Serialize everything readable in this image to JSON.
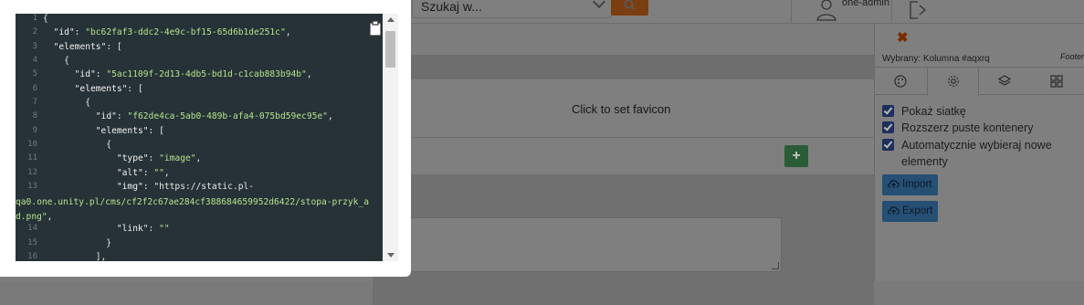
{
  "topbar": {
    "search_text": "Szukaj w...",
    "user_name": "one-admin"
  },
  "canvas": {
    "favicon_text": "Click to set favicon",
    "add_symbol": "+"
  },
  "panel": {
    "close_symbol": "✖",
    "selected_text": "Wybrany: Kolumna #aqxrq",
    "footer_tag": "Footer",
    "tabs": [
      {
        "icon": "palette-icon",
        "active": false
      },
      {
        "icon": "gear-icon",
        "active": true
      },
      {
        "icon": "layers-icon",
        "active": false
      },
      {
        "icon": "grid-icon",
        "active": false
      }
    ],
    "checkboxes": [
      {
        "label": "Pokaż siatkę",
        "checked": true
      },
      {
        "label": "Rozszerz puste kontenery",
        "checked": true
      },
      {
        "label": "Automatycznie wybieraj nowe elementy",
        "checked": true
      }
    ],
    "import_label": "Import",
    "export_label": "Export"
  },
  "modal": {
    "code_lines": [
      {
        "n": "1",
        "t": "{"
      },
      {
        "n": "2",
        "t": "  \"id\": \"bc62faf3-ddc2-4e9c-bf15-65d6b1de251c\","
      },
      {
        "n": "3",
        "t": "  \"elements\": ["
      },
      {
        "n": "4",
        "t": "    {"
      },
      {
        "n": "5",
        "t": "      \"id\": \"5ac1109f-2d13-4db5-bd1d-c1cab883b94b\","
      },
      {
        "n": "6",
        "t": "      \"elements\": ["
      },
      {
        "n": "7",
        "t": "        {"
      },
      {
        "n": "8",
        "t": "          \"id\": \"f62de4ca-5ab0-489b-afa4-075bd59ec95e\","
      },
      {
        "n": "9",
        "t": "          \"elements\": ["
      },
      {
        "n": "10",
        "t": "            {"
      },
      {
        "n": "11",
        "t": "              \"type\": \"image\","
      },
      {
        "n": "12",
        "t": "              \"alt\": \"\","
      },
      {
        "n": "13",
        "t": "              \"img\": \"https://static.pl-",
        "wrap": "qa0.one.unity.pl/cms/cf2f2c67ae284cf388684659952d6422/stopa-przyk_ad.png\","
      },
      {
        "n": "14",
        "t": "              \"link\": \"\""
      },
      {
        "n": "15",
        "t": "            }"
      },
      {
        "n": "16",
        "t": "          ],"
      }
    ]
  }
}
